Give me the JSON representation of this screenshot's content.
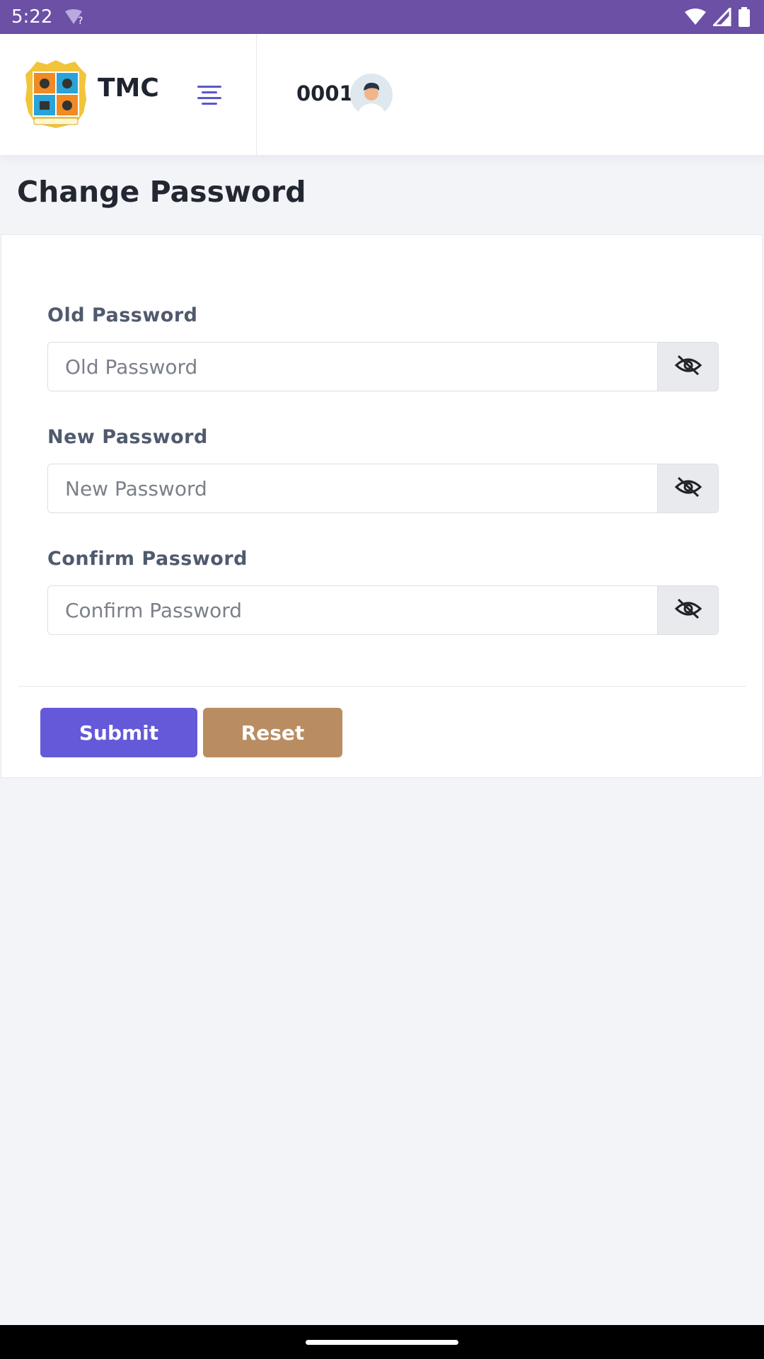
{
  "status_bar": {
    "time": "5:22",
    "wifi_hint": "?"
  },
  "header": {
    "brand": "TMC",
    "user_id": "0001",
    "menu_icon": "menu-lines-icon",
    "logo_icon": "municipal-crest"
  },
  "page": {
    "title": "Change Password"
  },
  "form": {
    "fields": [
      {
        "label": "Old Password",
        "placeholder": "Old Password",
        "value": ""
      },
      {
        "label": "New Password",
        "placeholder": "New Password",
        "value": ""
      },
      {
        "label": "Confirm Password",
        "placeholder": "Confirm Password",
        "value": ""
      }
    ],
    "toggle_icon": "eye-off-icon",
    "submit_label": "Submit",
    "reset_label": "Reset"
  },
  "colors": {
    "status_bar": "#6b50a6",
    "submit": "#6459d8",
    "reset": "#b98c62",
    "menu_icon": "#5b57c9"
  }
}
